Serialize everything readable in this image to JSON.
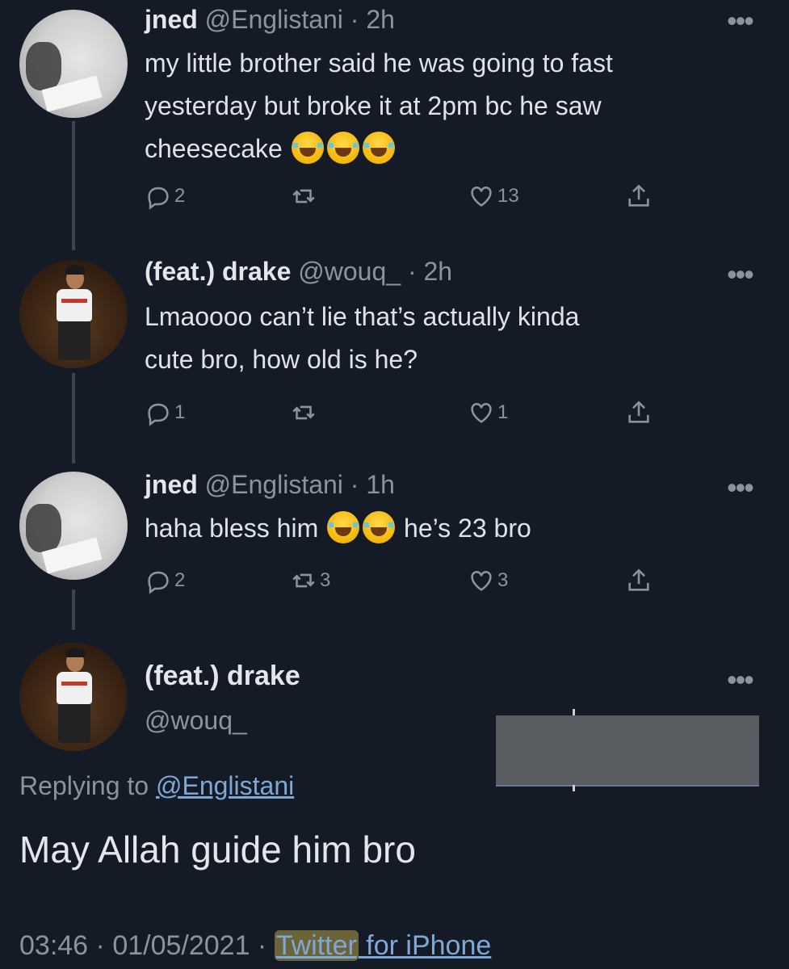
{
  "tweets": [
    {
      "name": "jned",
      "meta": " @Englistani · 2h",
      "lines": [
        "my little brother said he was going to fast",
        "yesterday but broke it at 2pm bc he saw",
        "cheesecake"
      ],
      "emojis": [
        "face-with-tears-of-joy",
        "face-with-tears-of-joy",
        "loudly-crying-face"
      ],
      "replies": "2",
      "retweets": "",
      "likes": "13"
    },
    {
      "name": "(feat.) drake",
      "meta": " @wouq_ · 2h",
      "lines": [
        "Lmaoooo can’t lie that’s actually kinda",
        "cute bro, how old is he?"
      ],
      "replies": "1",
      "retweets": "",
      "likes": "1"
    },
    {
      "name": "jned",
      "meta": " @Englistani · 1h",
      "text_before": "haha bless him",
      "emojis": [
        "face-with-tears-of-joy",
        "face-with-tears-of-joy"
      ],
      "text_after": "he’s 23 bro",
      "replies": "2",
      "retweets": "3",
      "likes": "3"
    }
  ],
  "focused": {
    "name": "(feat.) drake",
    "handle": "@wouq_",
    "replying_prefix": "Replying to ",
    "replying_to": "@Englistani",
    "text": "May Allah guide him bro",
    "time": "03:46",
    "date": "01/05/2021",
    "source_highlighted": "Twitter",
    "source_rest": " for iPhone"
  },
  "icons": [
    "reply-icon",
    "retweet-icon",
    "like-icon",
    "share-icon",
    "more-icon"
  ],
  "colors": {
    "background": "#141b26",
    "muted": "#8a939e",
    "link": "#7fa8d6"
  }
}
